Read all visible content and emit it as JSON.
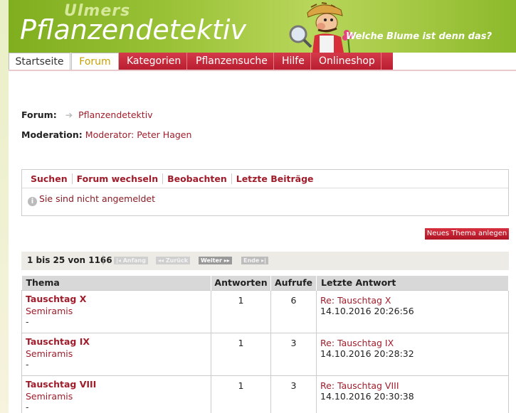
{
  "header": {
    "brand_top": "Ulmers",
    "title": "Pflanzendetektiv",
    "slogan": "Welche Blume ist denn das?"
  },
  "nav": {
    "tabs": [
      {
        "label": "Startseite"
      },
      {
        "label": "Forum"
      },
      {
        "label": "Kategorien"
      },
      {
        "label": "Pflanzensuche"
      },
      {
        "label": "Hilfe"
      },
      {
        "label": "Onlineshop"
      }
    ]
  },
  "forum": {
    "label": "Forum:",
    "name": "Pflanzendetektiv",
    "moderation_label": "Moderation:",
    "moderator": "Moderator: Peter Hagen"
  },
  "tools": {
    "links": [
      "Suchen",
      "Forum wechseln",
      "Beobachten",
      "Letzte Beiträge"
    ],
    "login_status": "Sie sind nicht angemeldet"
  },
  "new_topic_label": "Neues Thema anlegen",
  "pagination": {
    "count": "1 bis 25 von 1166",
    "sep": "|",
    "first": "Anfang",
    "prev": "Zurück",
    "next": "Weiter",
    "last": "Ende"
  },
  "table": {
    "headers": [
      "Thema",
      "Antworten",
      "Aufrufe",
      "Letzte Antwort"
    ],
    "rows": [
      {
        "topic": "Tauschtag X",
        "author": "Semiramis",
        "extra": "-",
        "replies": "1",
        "views": "6",
        "last_title": "Re: Tauschtag X",
        "last_date": "14.10.2016 20:26:56"
      },
      {
        "topic": "Tauschtag IX",
        "author": "Semiramis",
        "extra": "-",
        "replies": "1",
        "views": "3",
        "last_title": "Re: Tauschtag IX",
        "last_date": "14.10.2016 20:28:32"
      },
      {
        "topic": "Tauschtag VIII",
        "author": "Semiramis",
        "extra": "-",
        "replies": "1",
        "views": "3",
        "last_title": "Re: Tauschtag VIII",
        "last_date": "14.10.2016 20:30:38"
      }
    ]
  },
  "colors": {
    "accent_red": "#a01c2a",
    "header_green": "#8cb92b",
    "forum_tab_text": "#c8a100"
  }
}
